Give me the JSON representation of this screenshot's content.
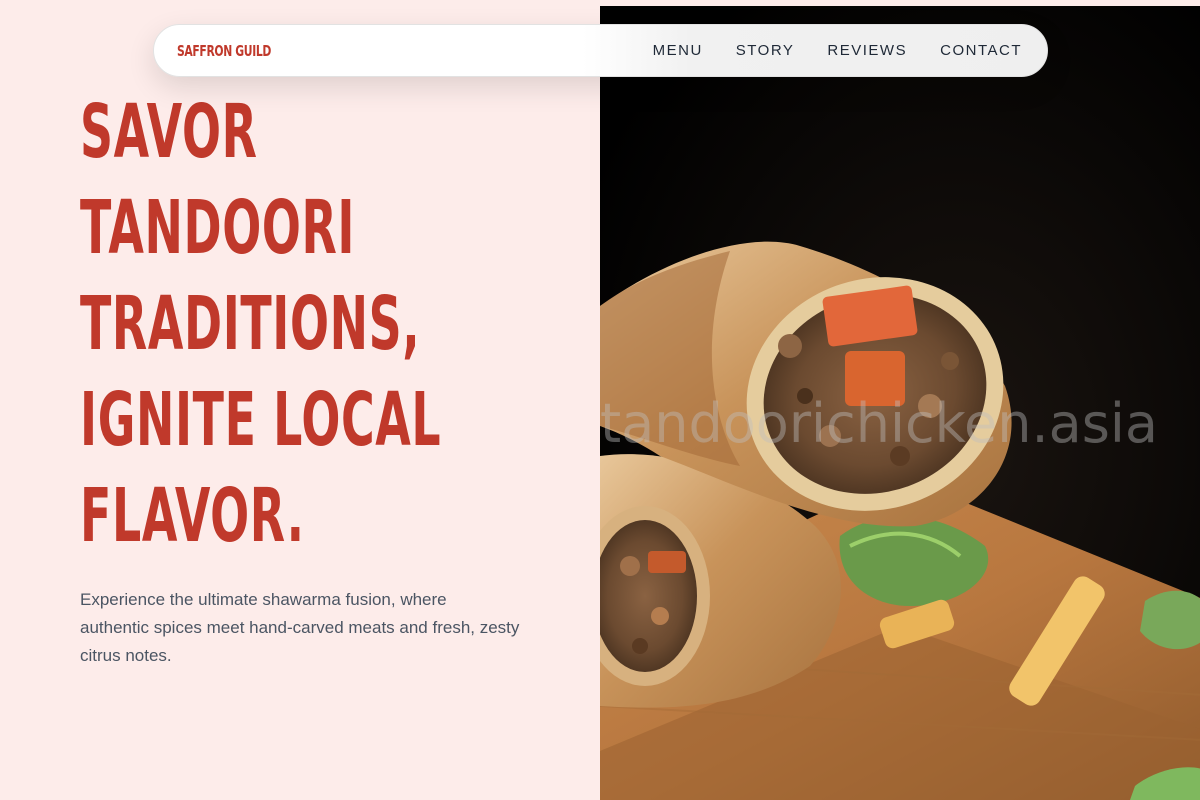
{
  "nav": {
    "brand": "SAFFRON GUILD",
    "links": [
      "MENU",
      "STORY",
      "REVIEWS",
      "CONTACT"
    ]
  },
  "hero": {
    "title_lines": [
      "SAVOR",
      "TANDOORI",
      "TRADITIONS,",
      "IGNITE LOCAL",
      "FLAVOR."
    ],
    "description": "Experience the ultimate shawarma fusion, where authentic spices meet hand-carved meats and fresh, zesty citrus notes."
  },
  "image": {
    "subject": "grilled shawarma wrap on wooden board",
    "watermark": "tandoorichicken.asia"
  },
  "colors": {
    "accent": "#c0392b",
    "background": "#fdecea",
    "text": "#4b5563",
    "nav_text": "#1f2937"
  }
}
